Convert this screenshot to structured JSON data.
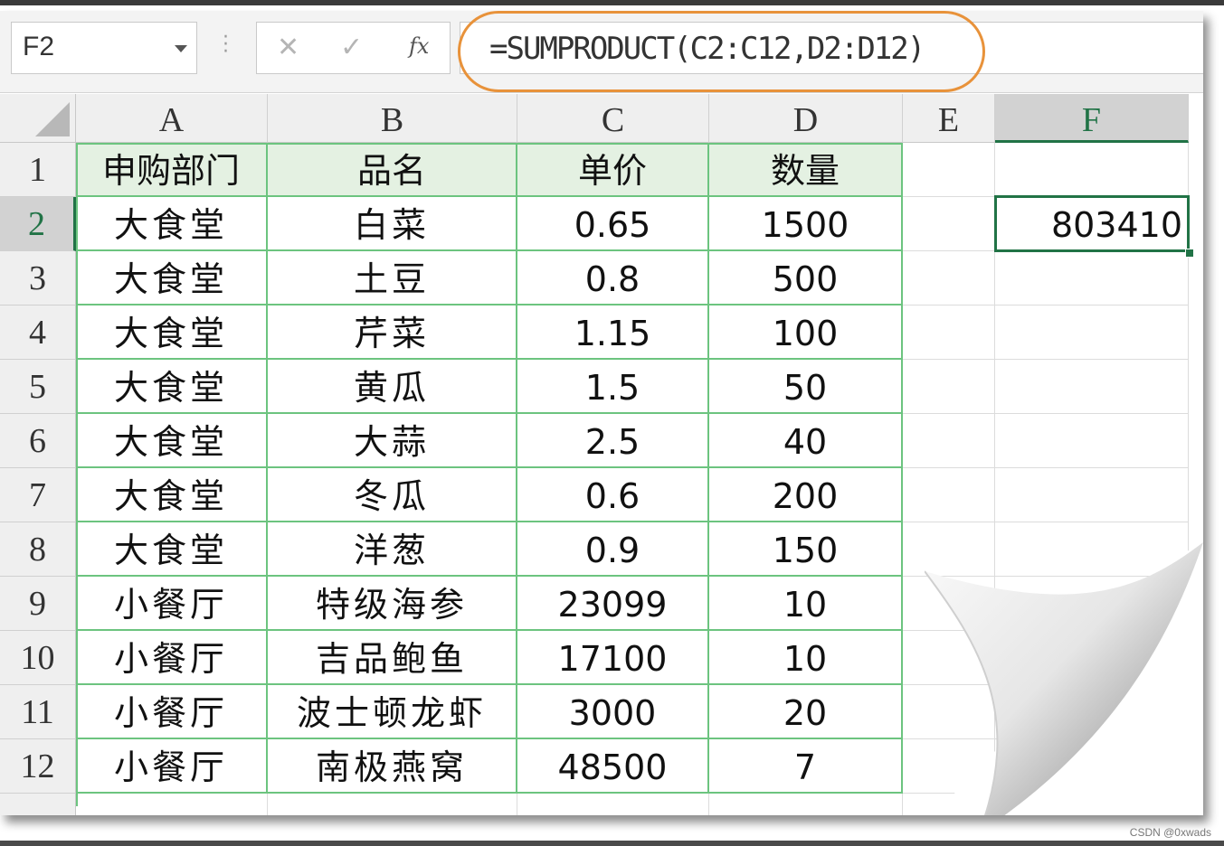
{
  "name_box": "F2",
  "formula_bar": {
    "cancel_icon": "close-icon",
    "confirm_icon": "check-icon",
    "fx_label": "fx",
    "formula": "=SUMPRODUCT(C2:C12,D2:D12)"
  },
  "columns": [
    "A",
    "B",
    "C",
    "D",
    "E",
    "F"
  ],
  "rows": [
    "1",
    "2",
    "3",
    "4",
    "5",
    "6",
    "7",
    "8",
    "9",
    "10",
    "11",
    "12"
  ],
  "table": {
    "header": [
      "申购部门",
      "品名",
      "单价",
      "数量"
    ],
    "rows": [
      [
        "大食堂",
        "白菜",
        "0.65",
        "1500"
      ],
      [
        "大食堂",
        "土豆",
        "0.8",
        "500"
      ],
      [
        "大食堂",
        "芹菜",
        "1.15",
        "100"
      ],
      [
        "大食堂",
        "黄瓜",
        "1.5",
        "50"
      ],
      [
        "大食堂",
        "大蒜",
        "2.5",
        "40"
      ],
      [
        "大食堂",
        "冬瓜",
        "0.6",
        "200"
      ],
      [
        "大食堂",
        "洋葱",
        "0.9",
        "150"
      ],
      [
        "小餐厅",
        "特级海参",
        "23099",
        "10"
      ],
      [
        "小餐厅",
        "吉品鲍鱼",
        "17100",
        "10"
      ],
      [
        "小餐厅",
        "波士顿龙虾",
        "3000",
        "20"
      ],
      [
        "小餐厅",
        "南极燕窝",
        "48500",
        "7"
      ]
    ]
  },
  "result_cell": "803410",
  "watermark": "CSDN @0xwads",
  "colors": {
    "accent_green": "#217346",
    "table_border": "#6cc47f",
    "header_fill": "#e4f1e2",
    "highlight_oval": "#e8923a"
  }
}
